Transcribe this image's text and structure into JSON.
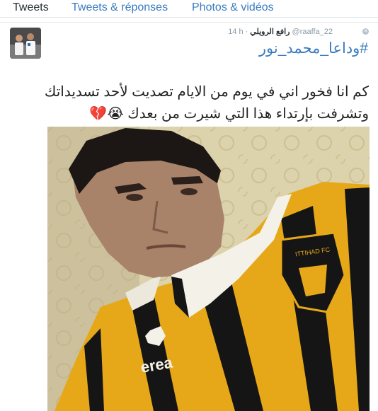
{
  "tabs": [
    {
      "label": "Tweets",
      "active": true
    },
    {
      "label": "Tweets & réponses",
      "active": false
    },
    {
      "label": "Photos & vidéos",
      "active": false
    }
  ],
  "tweet": {
    "handle": "@raaffa_22",
    "author": "رافع الرويلي",
    "time": "14 h",
    "hashtag": "#وداعا_محمد_نور",
    "line1": "كم انا فخور اني في يوم من الايام تصديت لأحد تسديداتك",
    "line2": "وتشرفت بإرتداء هذا التي شيرت من بعدك",
    "emojis": "😭💔",
    "photo": {
      "crest_text": "ITTIHAD FC",
      "brand_text": "erea"
    }
  },
  "colors": {
    "link": "#3a7bbf",
    "jersey_yellow": "#e6a818",
    "jersey_black": "#151515"
  },
  "icons": [
    "close-icon",
    "avatar",
    "crest-icon",
    "errea-logo-icon"
  ]
}
